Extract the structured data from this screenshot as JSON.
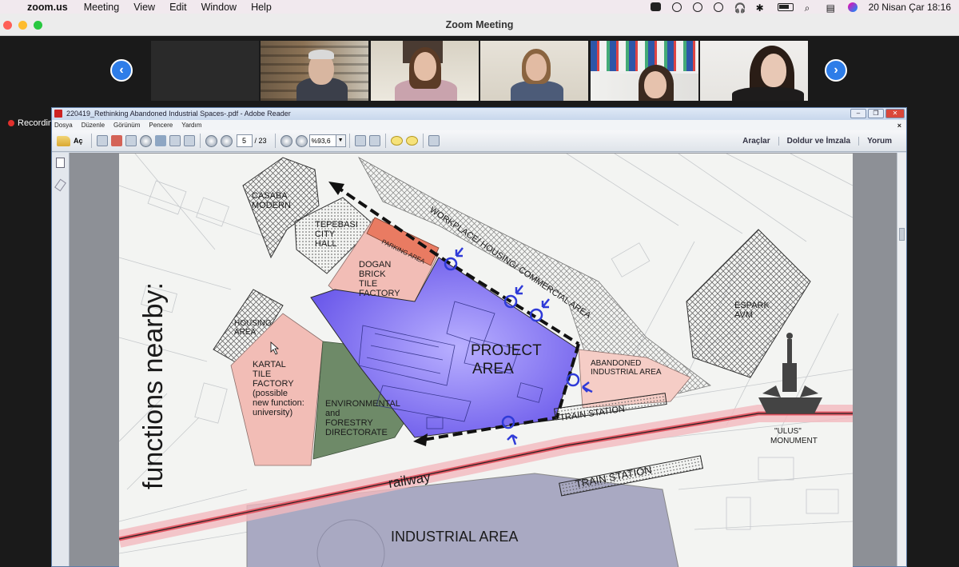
{
  "menubar": {
    "app_name": "zoom.us",
    "items": [
      "Meeting",
      "View",
      "Edit",
      "Window",
      "Help"
    ],
    "clock": "20 Nisan Çar  18:16"
  },
  "zoom": {
    "window_title": "Zoom Meeting",
    "recording_label": "Recording",
    "prev_glyph": "‹",
    "next_glyph": "›"
  },
  "reader": {
    "window_title": "220419_Rethinking Abandoned Industrial Spaces-.pdf - Adobe Reader",
    "menu": [
      "Dosya",
      "Düzenle",
      "Görünüm",
      "Pencere",
      "Yardım"
    ],
    "open_label": "Aç",
    "page_current": "5",
    "page_total": "/ 23",
    "zoom": "%93,6",
    "right_tools": [
      "Araçlar",
      "Doldur ve İmzala",
      "Yorum"
    ]
  },
  "map": {
    "side_title": "functions nearby:",
    "labels": {
      "casaba": [
        "CASABA",
        "MODERN"
      ],
      "tepebasi": [
        "TEPEBASI",
        "CITY",
        "HALL"
      ],
      "parking": "PARKING AREA",
      "dogan": [
        "DOGAN",
        "BRICK",
        "TILE",
        "FACTORY"
      ],
      "workplace": "WORKPLACE/ HOUSING/ COMMERCIAL AREA",
      "espark": [
        "ESPARK",
        "AVM"
      ],
      "housing": [
        "HOUSING",
        "AREA"
      ],
      "kartal": [
        "KARTAL",
        "TILE",
        "FACTORY",
        "(possible",
        "new function:",
        "university)"
      ],
      "environmental": [
        "ENVIRONMENTAL",
        "and",
        "FORESTRY",
        "DIRECTORATE"
      ],
      "project": [
        "PROJECT",
        "AREA"
      ],
      "abandoned": [
        "ABANDONED",
        "INDUSTRIAL AREA"
      ],
      "train_station_1": "TRAIN STATION",
      "train_station_2": "TRAIN STATION",
      "ulus": [
        "\"ULUS\"",
        "MONUMENT"
      ],
      "railway": "railway",
      "industrial": "INDUSTRIAL AREA"
    }
  },
  "colors": {
    "project_area": "#7b68f0",
    "pink_zone": "#f2bdb6",
    "green_zone": "#6e8a68",
    "parking": "#e97b62",
    "railway": "#e35a66",
    "industrial": "#a9a9c2",
    "zoom_blue": "#2e7de8"
  }
}
